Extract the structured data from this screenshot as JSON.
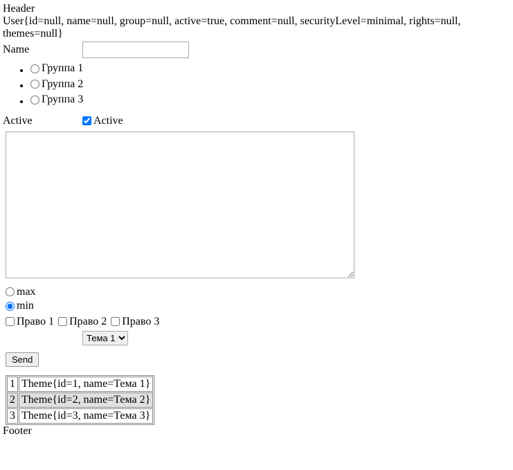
{
  "header": "Header",
  "debug_user": "User{id=null, name=null, group=null, active=true, comment=null, securityLevel=minimal, rights=null, themes=null}",
  "form": {
    "name": {
      "label": "Name",
      "value": ""
    },
    "groups": [
      {
        "label": "Группа 1",
        "checked": false
      },
      {
        "label": "Группа 2",
        "checked": false
      },
      {
        "label": "Группа 3",
        "checked": false
      }
    ],
    "active": {
      "label": "Active",
      "checkbox_label": "Active",
      "checked": true
    },
    "comment": "",
    "security": [
      {
        "label": "max",
        "checked": false
      },
      {
        "label": "min",
        "checked": true
      }
    ],
    "rights": [
      {
        "label": "Право 1",
        "checked": false
      },
      {
        "label": "Право 2",
        "checked": false
      },
      {
        "label": "Право 3",
        "checked": false
      }
    ],
    "theme_select": {
      "selected": "Тема 1"
    },
    "submit_label": "Send"
  },
  "themes_table": [
    {
      "id": "1",
      "value": "Theme{id=1, name=Тема 1}",
      "highlight": false
    },
    {
      "id": "2",
      "value": "Theme{id=2, name=Тема 2}",
      "highlight": true
    },
    {
      "id": "3",
      "value": "Theme{id=3, name=Тема 3}",
      "highlight": false
    }
  ],
  "footer": "Footer"
}
